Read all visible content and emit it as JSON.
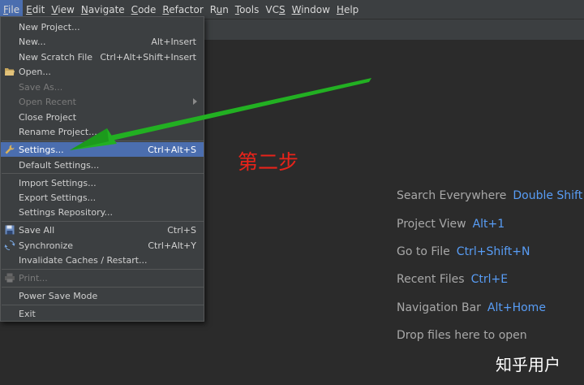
{
  "menubar": {
    "items": [
      {
        "pre": "",
        "u": "F",
        "post": "ile"
      },
      {
        "pre": "",
        "u": "E",
        "post": "dit"
      },
      {
        "pre": "",
        "u": "V",
        "post": "iew"
      },
      {
        "pre": "",
        "u": "N",
        "post": "avigate"
      },
      {
        "pre": "",
        "u": "C",
        "post": "ode"
      },
      {
        "pre": "",
        "u": "R",
        "post": "efactor"
      },
      {
        "pre": "R",
        "u": "u",
        "post": "n"
      },
      {
        "pre": "",
        "u": "T",
        "post": "ools"
      },
      {
        "pre": "VC",
        "u": "S",
        "post": ""
      },
      {
        "pre": "",
        "u": "W",
        "post": "indow"
      },
      {
        "pre": "",
        "u": "H",
        "post": "elp"
      }
    ]
  },
  "file_menu": {
    "new_project": "New Project...",
    "new": "New...",
    "new_shortcut": "Alt+Insert",
    "new_scratch": "New Scratch File",
    "new_scratch_shortcut": "Ctrl+Alt+Shift+Insert",
    "open": "Open...",
    "save_as": "Save As...",
    "open_recent": "Open Recent",
    "close_project": "Close Project",
    "rename_project": "Rename Project...",
    "settings": "Settings...",
    "settings_shortcut": "Ctrl+Alt+S",
    "default_settings": "Default Settings...",
    "import_settings": "Import Settings...",
    "export_settings": "Export Settings...",
    "settings_repository": "Settings Repository...",
    "save_all": "Save All",
    "save_all_shortcut": "Ctrl+S",
    "synchronize": "Synchronize",
    "synchronize_shortcut": "Ctrl+Alt+Y",
    "invalidate_caches": "Invalidate Caches / Restart...",
    "print": "Print...",
    "power_save_mode": "Power Save Mode",
    "exit": "Exit"
  },
  "welcome": {
    "hints": [
      {
        "text": "Search Everywhere",
        "key": "Double Shift"
      },
      {
        "text": "Project View",
        "key": "Alt+1"
      },
      {
        "text": "Go to File",
        "key": "Ctrl+Shift+N"
      },
      {
        "text": "Recent Files",
        "key": "Ctrl+E"
      },
      {
        "text": "Navigation Bar",
        "key": "Alt+Home"
      },
      {
        "text": "Drop files here to open",
        "key": ""
      }
    ]
  },
  "annotation": {
    "step_text": "第二步",
    "color": "#e8231a",
    "arrow_color": "#22b022"
  },
  "watermark": "知乎用户",
  "colors": {
    "selection": "#4b6eaf",
    "shortcut_key": "#589df6",
    "menu_bg": "#3c3f41",
    "editor_bg": "#2b2b2b"
  }
}
